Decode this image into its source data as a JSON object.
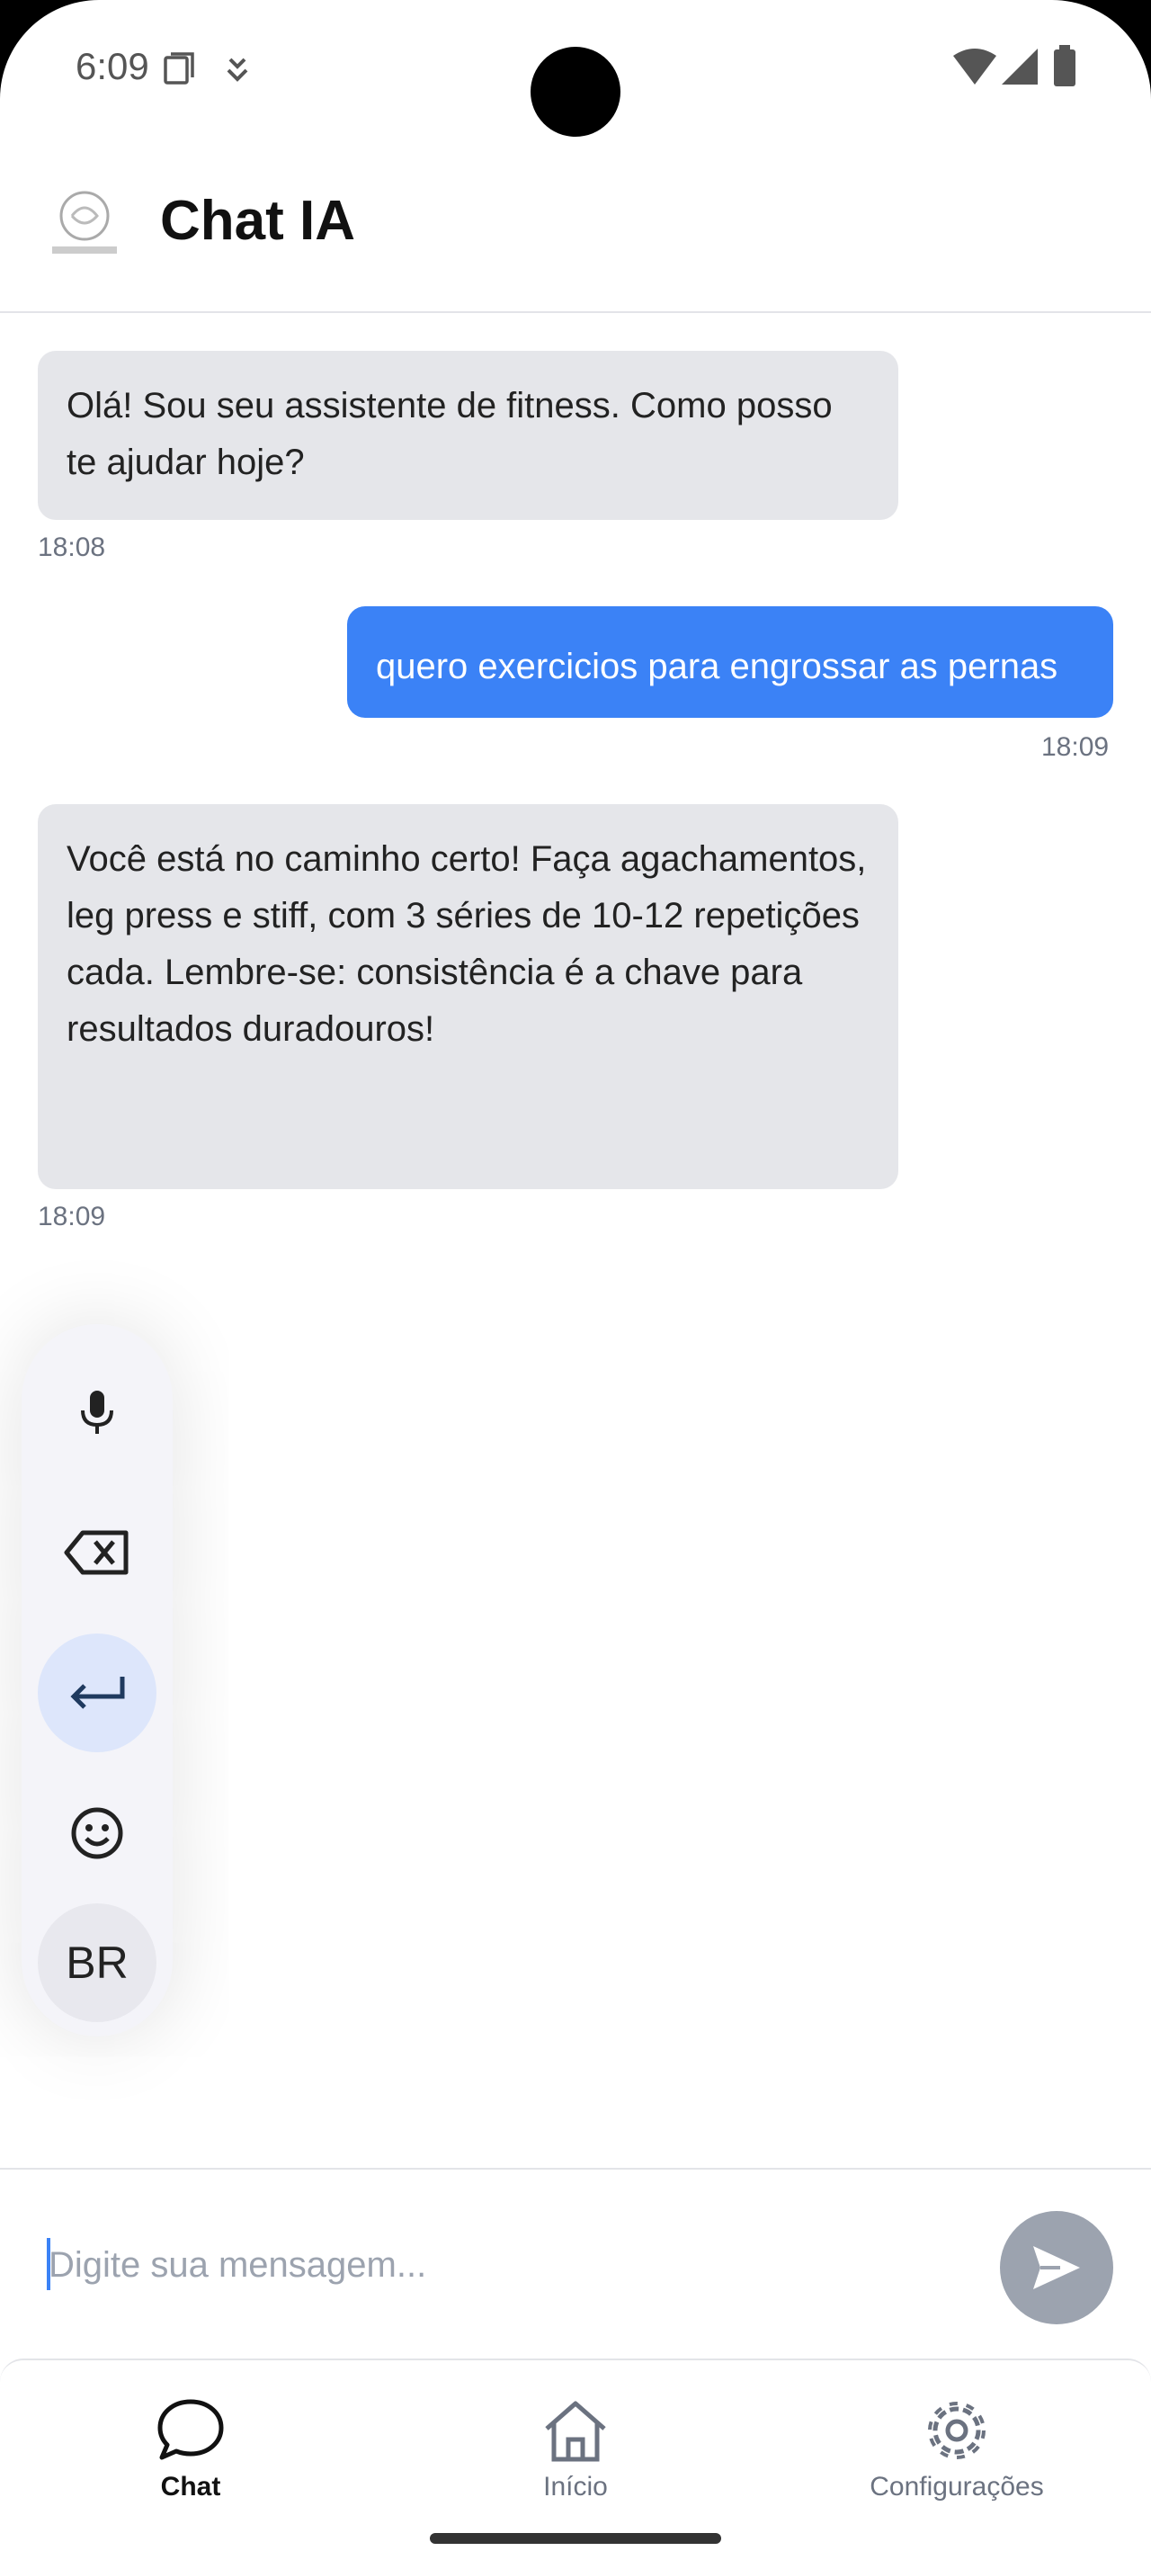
{
  "status_bar": {
    "time": "6:09"
  },
  "header": {
    "title": "Chat IA"
  },
  "messages": [
    {
      "sender": "bot",
      "text": "Olá! Sou seu assistente de fitness. Como posso te ajudar hoje?",
      "time": "18:08"
    },
    {
      "sender": "user",
      "text": "quero exercicios para engrossar as pernas",
      "time": "18:09"
    },
    {
      "sender": "bot",
      "text": "Você está no caminho certo! Faça agachamentos, leg press e stiff, com 3 séries de 10-12 repetições cada. Lembre-se: consistência é a chave para resultados duradouros!",
      "time": "18:09"
    }
  ],
  "keyboard_toolbar": {
    "items": [
      "microphone-icon",
      "backspace-icon",
      "enter-icon",
      "emoji-icon"
    ],
    "language_label": "BR"
  },
  "composer": {
    "placeholder": "Digite sua mensagem...",
    "value": ""
  },
  "tabs": [
    {
      "label": "Chat",
      "icon": "chat-bubble-icon",
      "active": true
    },
    {
      "label": "Início",
      "icon": "home-icon",
      "active": false
    },
    {
      "label": "Configurações",
      "icon": "gear-icon",
      "active": false
    }
  ],
  "colors": {
    "accent": "#3b82f6",
    "bot_bubble": "#e5e6ea",
    "send_button": "#9ca3af"
  }
}
